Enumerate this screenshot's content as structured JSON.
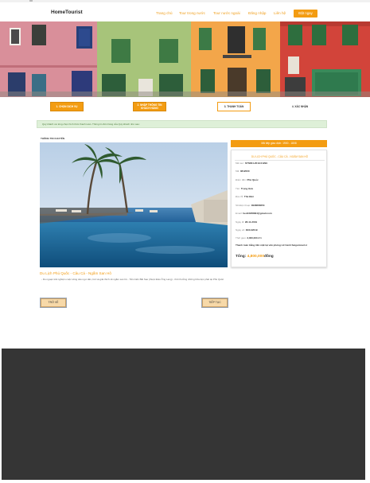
{
  "header": {
    "logo": "HomeTourist",
    "nav": [
      "Trang chủ",
      "Tour trong nước",
      "Tour nước ngoài",
      "Đăng nhập",
      "Liên hệ"
    ],
    "cta": "Đặt ngay"
  },
  "steps": [
    {
      "label": "1. CHỌN DỊCH VỤ",
      "state": "done"
    },
    {
      "label": "2. NHẬP THÔNG TIN KHÁCH HÀNG",
      "state": "done"
    },
    {
      "label": "3. THANH TOÁN",
      "state": "current"
    },
    {
      "label": "4. XÁC NHẬN",
      "state": "pending"
    }
  ],
  "notice": "Quý khách vui lòng chọn hình thức thanh toán. Thông tin đơn hàng của Quý khách như sau:",
  "tour_section_title": "THÔNG TIN CHUYẾN",
  "tour": {
    "name": "Du Lịch Phú Quốc - Câu Cá - Ngắm San Hô",
    "description": "- Du ngoạn trải nghiệm cuộc sống câu ngư dân, bơi và giải thích về ngắm san hô - Tắm biển Bãi Sao (thuộc Đảo Ông Lang) - thời thưởng những bữa tiệc phát tại Phú Quốc"
  },
  "buttons": {
    "back": "TRỞ VỀ",
    "next": "TIẾP TỤC"
  },
  "booking": {
    "header": "Mã tiếp giao dịch: 1900 - 1808",
    "title": "DU LỊCH PHÚ QUỐC - CÂU CÁ - NGẮM SAN HÔ",
    "rows": [
      {
        "label": "Mã tour:",
        "value": "STN004-2019-01299"
      },
      {
        "label": "Mã:",
        "value": "0812000"
      },
      {
        "label": "Điểm đến:",
        "value": "Phú Quốc"
      },
      {
        "label": "Tên:",
        "value": "Trọng Hưu"
      },
      {
        "label": "Địa chỉ:",
        "value": "Thủ Đức"
      },
      {
        "label": "Số Điện thoại:",
        "value": "0938666653"
      },
      {
        "label": "Email:",
        "value": "heo03238994@gmail.com"
      },
      {
        "label": "Ngày đi:",
        "value": "28-11-2019"
      },
      {
        "label": "Ngày về:",
        "value": "30/11/2019"
      },
      {
        "label": "Thời gian:",
        "value": "3,000,000 đ 1"
      }
    ],
    "note": "Thanh toán bằng tiền mặt tại văn phòng Lữ hành Saigontourist",
    "total_label": "Tổng:",
    "total_amount": "4,800,000",
    "total_unit": "đồng"
  },
  "colors": {
    "accent": "#f39c12",
    "notice_bg": "#def0d8",
    "footer": "#353535"
  }
}
